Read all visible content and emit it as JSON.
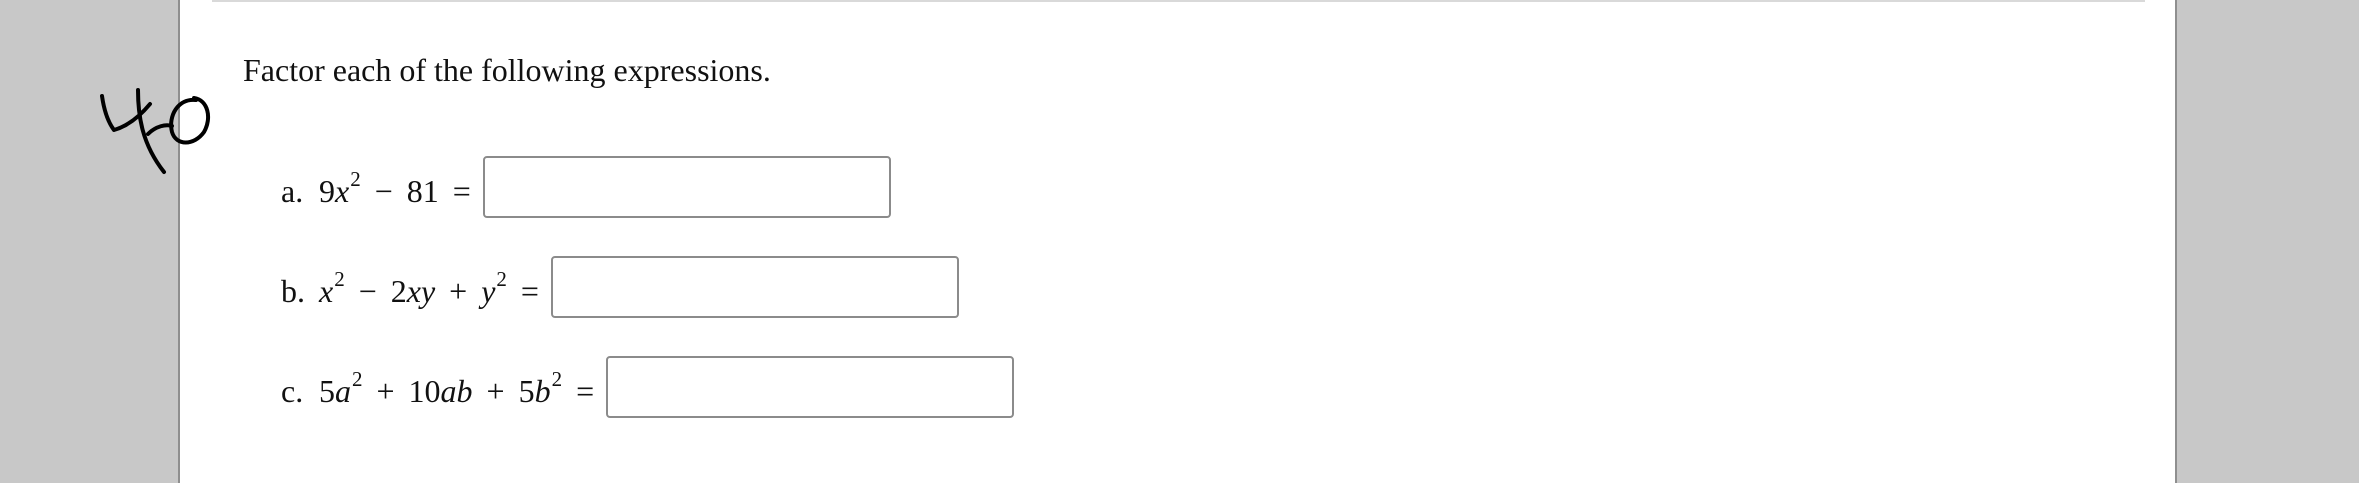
{
  "instruction": "Factor each of the following expressions.",
  "handwritten_note": "40",
  "problems": [
    {
      "label": "a.",
      "terms": [
        {
          "coef": "9",
          "var": "x",
          "sup": "2"
        },
        {
          "op": "−"
        },
        {
          "coef": "81"
        }
      ],
      "equals": "=",
      "answer_value": ""
    },
    {
      "label": "b.",
      "terms": [
        {
          "var": "x",
          "sup": "2"
        },
        {
          "op": "−"
        },
        {
          "coef": "2",
          "var": "xy"
        },
        {
          "op": "+"
        },
        {
          "var": "y",
          "sup": "2"
        }
      ],
      "equals": "=",
      "answer_value": ""
    },
    {
      "label": "c.",
      "terms": [
        {
          "coef": "5",
          "var": "a",
          "sup": "2"
        },
        {
          "op": "+"
        },
        {
          "coef": "10",
          "var": "ab"
        },
        {
          "op": "+"
        },
        {
          "coef": "5",
          "var": "b",
          "sup": "2"
        }
      ],
      "equals": "=",
      "answer_value": ""
    }
  ]
}
